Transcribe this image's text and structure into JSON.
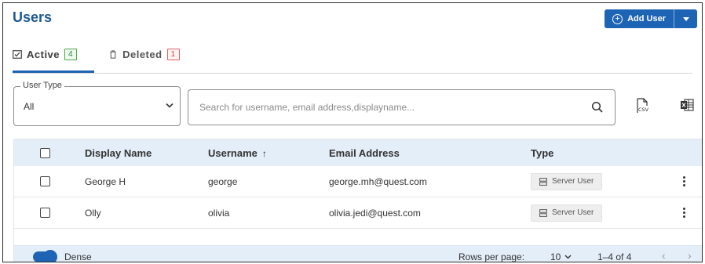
{
  "header": {
    "title": "Users",
    "add_user_label": "Add User",
    "accent_color": "#1e64b4",
    "title_color": "#1f5a8f"
  },
  "tabs": [
    {
      "label": "Active",
      "count": "4",
      "icon": "checkbox-icon",
      "active": true
    },
    {
      "label": "Deleted",
      "count": "1",
      "icon": "trash-icon",
      "active": false
    }
  ],
  "filters": {
    "user_type_label": "User Type",
    "user_type_value": "All",
    "search_placeholder": "Search for username, email address,displayname..."
  },
  "export": {
    "csv_icon": "csv-export-icon",
    "excel_icon": "excel-export-icon",
    "csv_text": "CSV"
  },
  "table": {
    "columns": {
      "display_name": "Display Name",
      "username": "Username",
      "sort_indicator": "↑",
      "email": "Email Address",
      "type": "Type"
    },
    "rows": [
      {
        "display_name": "George H",
        "username": "george",
        "email": "george.mh@quest.com",
        "type": "Server User"
      },
      {
        "display_name": "Olly",
        "username": "olivia",
        "email": "olivia.jedi@quest.com",
        "type": "Server User"
      }
    ]
  },
  "footer": {
    "dense_label": "Dense",
    "dense_on": true,
    "rows_per_page_label": "Rows per page:",
    "rows_per_page_value": "10",
    "range_text": "1–4 of 4",
    "prev_glyph": "‹",
    "next_glyph": "›"
  }
}
